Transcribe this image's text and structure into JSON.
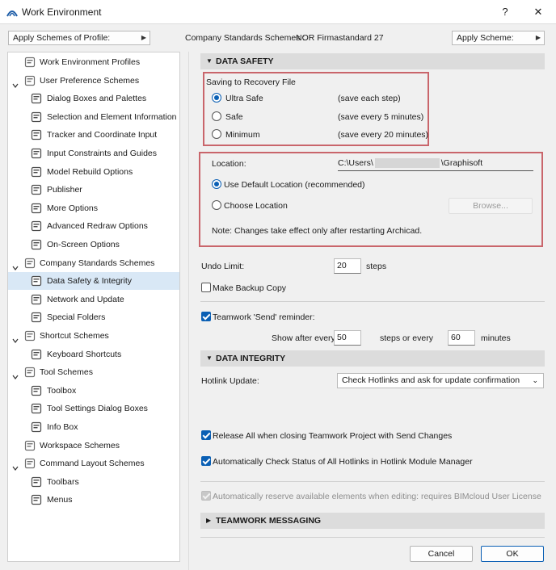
{
  "window": {
    "title": "Work Environment",
    "help_label": "?",
    "close_label": "✕"
  },
  "toolbar": {
    "apply_profile_label": "Apply Schemes of Profile:",
    "company_label": "Company Standards Schemes :",
    "company_value": "NOR Firmastandard 27",
    "apply_scheme_label": "Apply Scheme:"
  },
  "tree": [
    {
      "label": "Work Environment Profiles",
      "level": 0,
      "icon": "profiles-icon"
    },
    {
      "label": "User Preference Schemes",
      "level": 0,
      "expanded": true,
      "icon": "user-icon"
    },
    {
      "label": "Dialog Boxes and Palettes",
      "level": 1,
      "icon": "dialog-icon"
    },
    {
      "label": "Selection and Element Information",
      "level": 1,
      "icon": "selection-icon"
    },
    {
      "label": "Tracker and Coordinate Input",
      "level": 1,
      "icon": "xyz-icon"
    },
    {
      "label": "Input Constraints and Guides",
      "level": 1,
      "icon": "constraints-icon"
    },
    {
      "label": "Model Rebuild Options",
      "level": 1,
      "icon": "rebuild-icon"
    },
    {
      "label": "Publisher",
      "level": 1,
      "icon": "publisher-icon"
    },
    {
      "label": "More Options",
      "level": 1,
      "icon": "options-icon"
    },
    {
      "label": "Advanced Redraw Options",
      "level": 1,
      "icon": "redraw-icon"
    },
    {
      "label": "On-Screen Options",
      "level": 1,
      "icon": "onscreen-icon"
    },
    {
      "label": "Company Standards Schemes",
      "level": 0,
      "expanded": true,
      "icon": "company-icon"
    },
    {
      "label": "Data Safety & Integrity",
      "level": 1,
      "selected": true,
      "icon": "data-safety-icon"
    },
    {
      "label": "Network and Update",
      "level": 1,
      "icon": "network-icon"
    },
    {
      "label": "Special Folders",
      "level": 1,
      "icon": "folder-icon"
    },
    {
      "label": "Shortcut Schemes",
      "level": 0,
      "expanded": true,
      "icon": "shortcut-icon"
    },
    {
      "label": "Keyboard Shortcuts",
      "level": 1,
      "icon": "keyboard-icon"
    },
    {
      "label": "Tool Schemes",
      "level": 0,
      "expanded": true,
      "icon": "tool-icon"
    },
    {
      "label": "Toolbox",
      "level": 1,
      "icon": "toolbox-icon"
    },
    {
      "label": "Tool Settings Dialog Boxes",
      "level": 1,
      "icon": "tool-settings-icon"
    },
    {
      "label": "Info Box",
      "level": 1,
      "icon": "info-box-icon"
    },
    {
      "label": "Workspace Schemes",
      "level": 0,
      "icon": "workspace-icon"
    },
    {
      "label": "Command Layout Schemes",
      "level": 0,
      "expanded": true,
      "icon": "command-layout-icon"
    },
    {
      "label": "Toolbars",
      "level": 1,
      "icon": "toolbars-icon"
    },
    {
      "label": "Menus",
      "level": 1,
      "icon": "menus-icon"
    }
  ],
  "data_safety": {
    "header": "DATA SAFETY",
    "recovery_label": "Saving to Recovery File",
    "options": [
      {
        "label": "Ultra Safe",
        "note": "(save each step)",
        "selected": true
      },
      {
        "label": "Safe",
        "note": "(save every 5 minutes)",
        "selected": false
      },
      {
        "label": "Minimum",
        "note": "(save every 20 minutes)",
        "selected": false
      }
    ],
    "location_label": "Location:",
    "location_prefix": "C:\\Users\\",
    "location_suffix": "\\Graphisoft",
    "default_location": "Use Default Location (recommended)",
    "choose_location": "Choose Location",
    "browse_label": "Browse...",
    "note": "Note: Changes take effect only after restarting Archicad.",
    "undo_label": "Undo Limit:",
    "undo_value": "20",
    "undo_unit": "steps",
    "backup_label": "Make Backup Copy",
    "teamwork_label": "Teamwork 'Send' reminder:",
    "show_after": "Show after every",
    "steps_value": "50",
    "steps_or": "steps or every",
    "minutes_value": "60",
    "minutes_label": "minutes"
  },
  "data_integrity": {
    "header": "DATA INTEGRITY",
    "hotlink_label": "Hotlink Update:",
    "hotlink_value": "Check Hotlinks and ask for update confirmation",
    "release_all": "Release All when closing Teamwork Project with Send Changes",
    "auto_check": "Automatically Check Status of All Hotlinks in Hotlink Module Manager",
    "auto_reserve": "Automatically reserve available elements when editing: requires BIMcloud User License"
  },
  "teamwork_messaging": {
    "header": "TEAMWORK MESSAGING"
  },
  "footer": {
    "cancel_label": "Cancel",
    "ok_label": "OK"
  },
  "colors": {
    "accent": "#0a5fb4",
    "highlight_box": "#c9656b",
    "selected_row": "#d9e8f6"
  }
}
